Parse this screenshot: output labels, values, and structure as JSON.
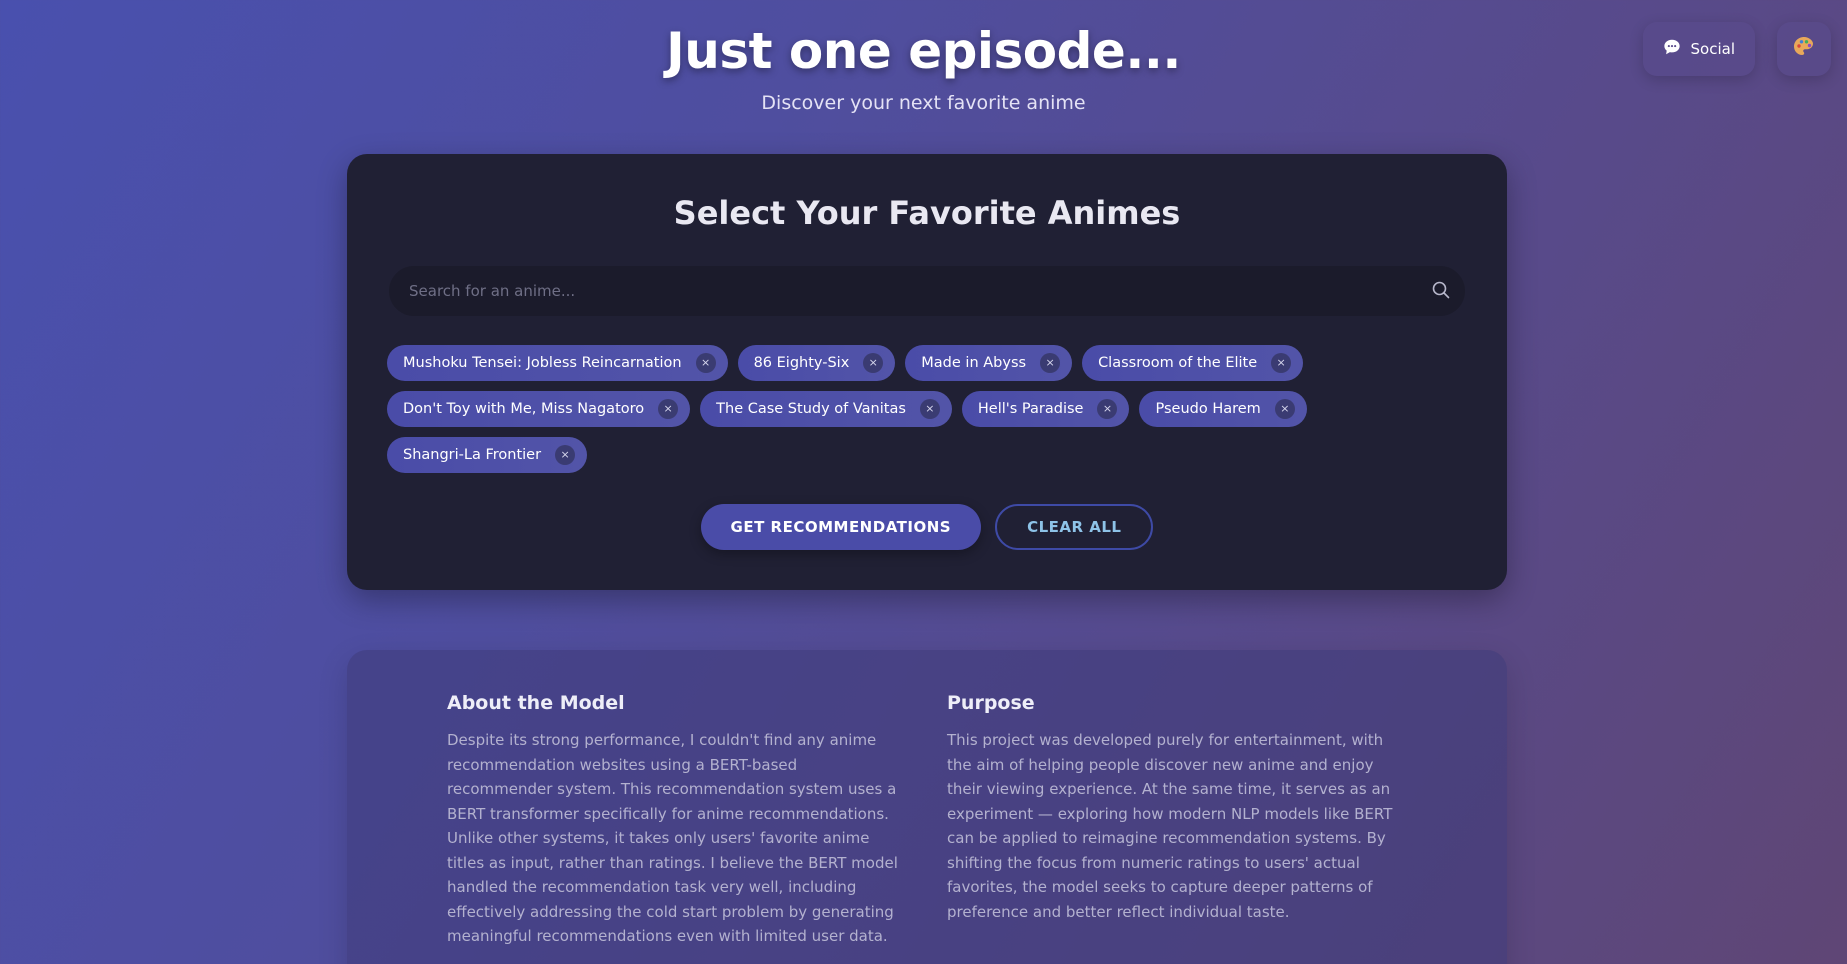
{
  "header": {
    "title": "Just one episode...",
    "subtitle": "Discover your next favorite anime"
  },
  "top_actions": {
    "social_label": "Social",
    "social_icon": "speech-bubble-icon",
    "theme_icon": "palette-icon"
  },
  "selector": {
    "title": "Select Your Favorite Animes",
    "search_placeholder": "Search for an anime...",
    "search_value": "",
    "remove_glyph": "×",
    "tag_rows": [
      [
        "Mushoku Tensei: Jobless Reincarnation",
        "86 Eighty-Six",
        "Made in Abyss",
        "Classroom of the Elite"
      ],
      [
        "Don't Toy with Me, Miss Nagatoro",
        "The Case Study of Vanitas",
        "Hell's Paradise",
        "Pseudo Harem"
      ],
      [
        "Shangri-La Frontier"
      ]
    ],
    "recommend_label": "GET RECOMMENDATIONS",
    "clear_label": "CLEAR ALL"
  },
  "about": {
    "model_heading": "About the Model",
    "model_text": "Despite its strong performance, I couldn't find any anime recommendation websites using a BERT-based recommender system. This recommendation system uses a BERT transformer specifically for anime recommendations. Unlike other systems, it takes only users' favorite anime titles as input, rather than ratings. I believe the BERT model handled the recommendation task very well, including effectively addressing the cold start problem by generating meaningful recommendations even with limited user data.",
    "purpose_heading": "Purpose",
    "purpose_text": "This project was developed purely for entertainment, with the aim of helping people discover new anime and enjoy their viewing experience. At the same time, it serves as an experiment — exploring how modern NLP models like BERT can be applied to reimagine recommendation systems. By shifting the focus from numeric ratings to users' actual favorites, the model seeks to capture deeper patterns of preference and better reflect individual taste."
  },
  "colors": {
    "accent": "#4a4ca8",
    "card_bg": "#202034",
    "clear_text": "#8ec3e8"
  }
}
